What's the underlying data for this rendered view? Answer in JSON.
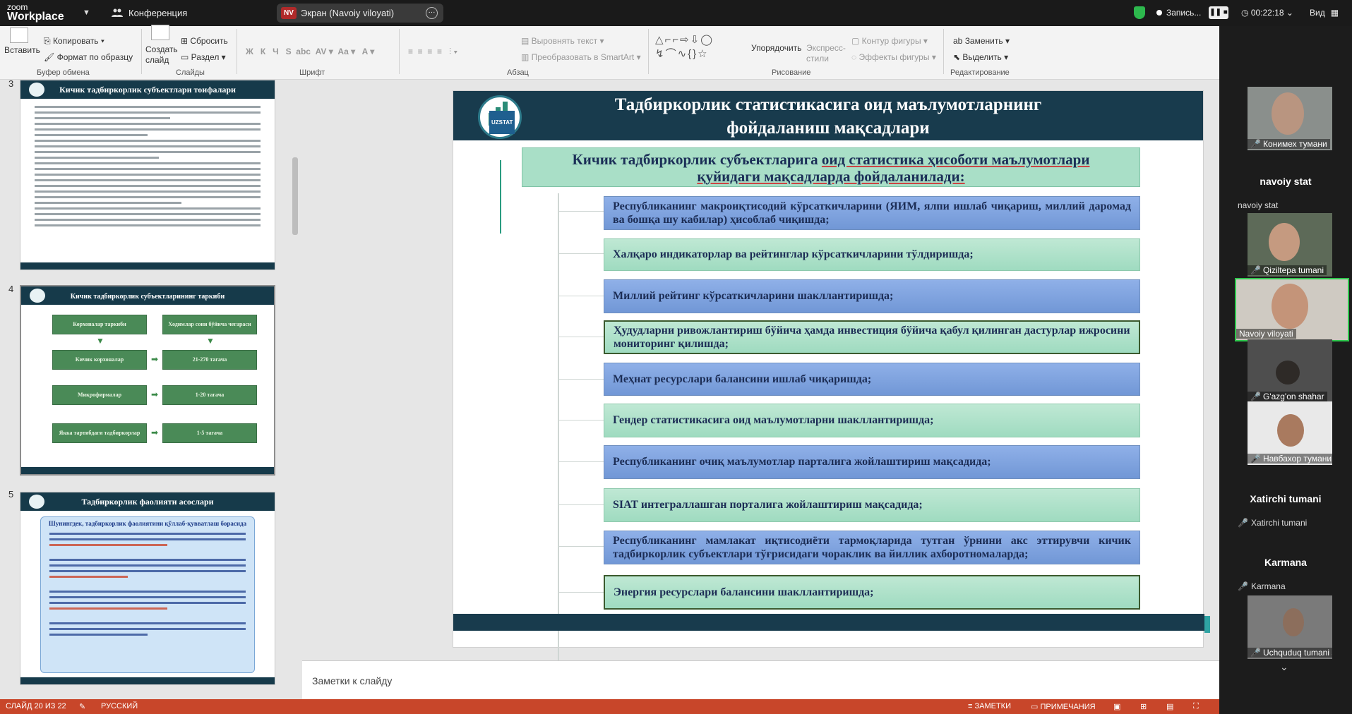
{
  "zoom": {
    "logo_top": "zoom",
    "logo_bottom": "Workplace",
    "conference": "Конференция",
    "share_badge": "NV",
    "share_title": "Экран (Navoiy viloyati)",
    "recording": "Запись...",
    "timer": "00:22:18",
    "view": "Вид"
  },
  "ribbon": {
    "paste": "Вставить",
    "copy": "Копировать",
    "format_painter": "Формат по образцу",
    "clipboard_group": "Буфер обмена",
    "new_slide": "Создать слайд",
    "reset": "Сбросить",
    "section": "Раздел",
    "slides_group": "Слайды",
    "font_group": "Шрифт",
    "align_text": "Выровнять текст",
    "convert_smartart": "Преобразовать в SmartArt",
    "paragraph_group": "Абзац",
    "arrange": "Упорядочить",
    "quick_styles": "Экспресс-стили",
    "shape_outline": "Контур фигуры",
    "shape_effects": "Эффекты фигуры",
    "drawing_group": "Рисование",
    "replace": "Заменить",
    "select": "Выделить",
    "editing_group": "Редактирование"
  },
  "thumbnails": [
    {
      "num": "3",
      "title": "Кичик тадбиркорлик субъектлари тоифалари"
    },
    {
      "num": "4",
      "title": "Кичик тадбиркорлик субъектларининг таркиби",
      "boxes": [
        "Корхоналар таркиби",
        "Ходимлар сони бўйича чегараси",
        "Кичик корхоналар",
        "21-270 тагача",
        "Микрофирмалар",
        "1-20 тагача",
        "Якка тартибдаги тадбиркорлар",
        "1-5 тагача"
      ]
    },
    {
      "num": "5",
      "title": "Тадбиркорлик фаолияти асослари",
      "subtitle": "Шунингдек, тадбиркорлик фаолиятини қўллаб-қувватлаш борасида"
    }
  ],
  "slide": {
    "header_line1": "Тадбиркорлик статистикасига оид маълумотларнинг",
    "header_line2": "фойдаланиш мақсадлари",
    "logo_text": "UZSTAT",
    "title_pre": "Кичик тадбиркорлик субъектларига ",
    "title_underlined": "оид статистика ҳисоботи маълумотлари",
    "title_line2": "қуйидаги мақсадларда фойдаланилади:",
    "items": [
      "Республиканинг макроиқтисодий кўрсаткичларини (ЯИМ, ялпи ишлаб чиқариш, миллий даромад ва бошқа шу кабилар) ҳисоблаб чиқишда;",
      "Халқаро индикаторлар ва рейтинглар кўрсаткичларини тўлдиришда;",
      "Миллий рейтинг кўрсаткичларини шакллантиришда;",
      "Ҳудудларни ривожлантириш бўйича ҳамда инвестиция бўйича қабул қилинган дастурлар ижросини мониторинг қилишда;",
      "Меҳнат ресурслари балансини ишлаб чиқаришда;",
      "Гендер статистикасига оид маълумотларни шакллантиришда;",
      "Республиканинг очиқ маълумотлар парталига жойлаштириш мақсадида;",
      "SIAT интеграллашган порталига жойлаштириш мақсадида;",
      "Республиканинг мамлакат иқтисодиёти тармоқларида тутган ўрнини акс эттирувчи кичик тадбиркорлик субъектлари тўғрисидаги чораклик ва йиллик ахборотномаларда;",
      "Энергия ресурслари балансини шакллантиришда;"
    ]
  },
  "notes_placeholder": "Заметки к слайду",
  "status": {
    "slide_counter": "СЛАЙД 20 ИЗ 22",
    "language": "РУССКИЙ",
    "notes": "ЗАМЕТКИ",
    "comments": "ПРИМЕЧАНИЯ"
  },
  "participants": {
    "tile1": "Конимех тумани",
    "group1": "navoiy stat",
    "label1": "navoiy stat",
    "tile2": "Qiziltepa tumani",
    "tile3": "Navoiy viloyati",
    "tile4": "G'azg'on shahar",
    "tile5": "Навбахор тумани",
    "group2": "Xatirchi tumani",
    "label2": "Xatirchi tumani",
    "group3": "Karmana",
    "label3": "Karmana",
    "tile6": "Uchquduq tumani sta..."
  },
  "colors": {
    "slide_header": "#183b4d",
    "item_blue": "#7f9fdc",
    "item_green": "#a9dfc7",
    "status_bar": "#c8462a"
  }
}
